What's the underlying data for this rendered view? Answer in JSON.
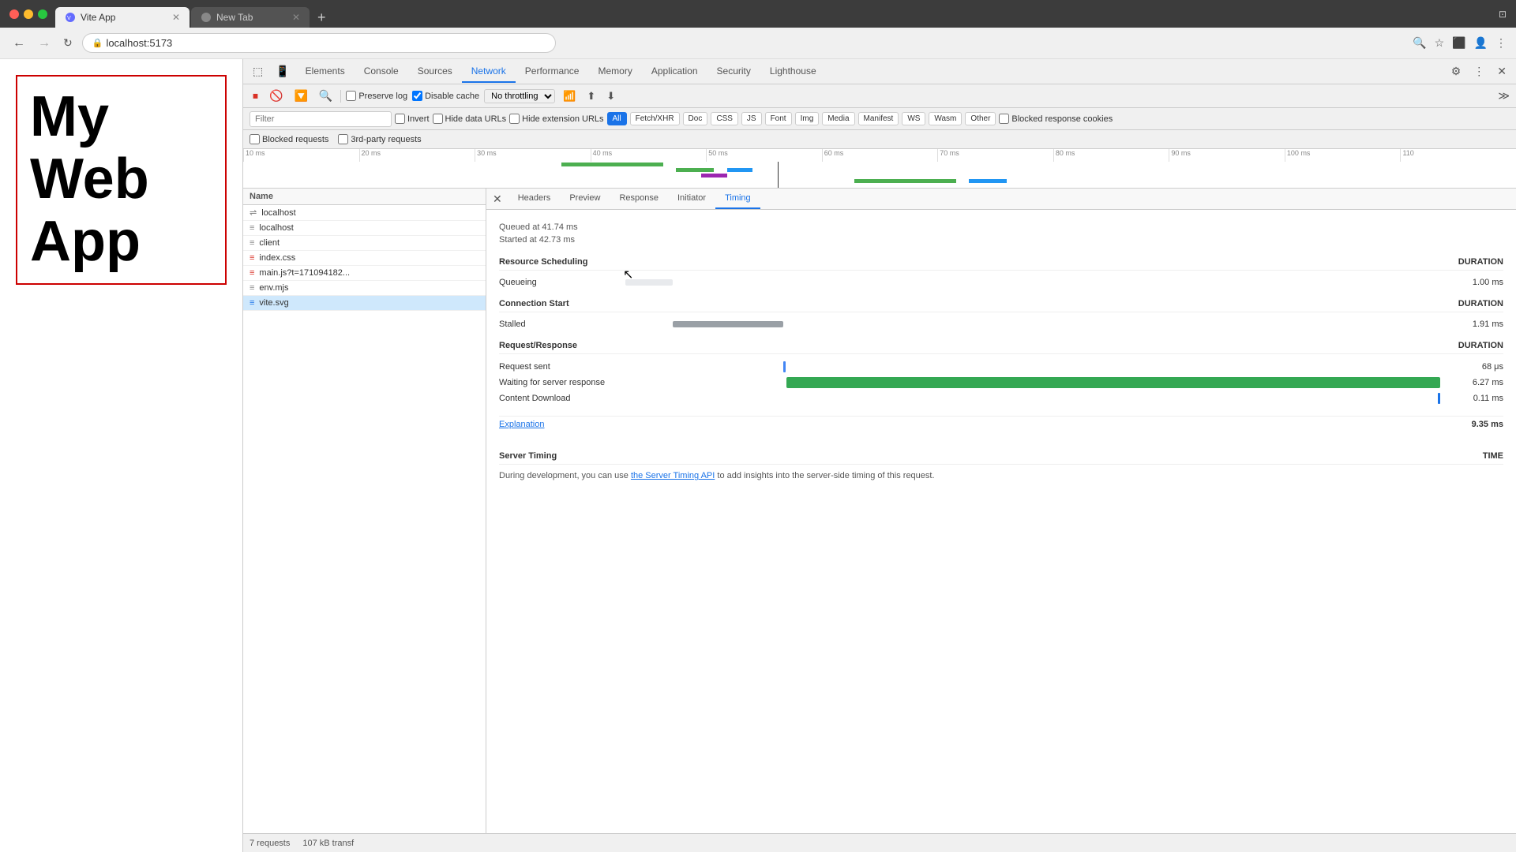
{
  "browser": {
    "tab1_title": "Vite App",
    "tab2_title": "New Tab",
    "url": "localhost:5173"
  },
  "webpage": {
    "title": "My Web App"
  },
  "devtools": {
    "tabs": [
      "Elements",
      "Console",
      "Sources",
      "Network",
      "Performance",
      "Memory",
      "Application",
      "Security",
      "Lighthouse"
    ],
    "active_tab": "Network"
  },
  "network_toolbar": {
    "preserve_log": "Preserve log",
    "disable_cache": "Disable cache",
    "throttle": "No throttling"
  },
  "filter_bar": {
    "placeholder": "Filter",
    "invert_label": "Invert",
    "hide_data_urls": "Hide data URLs",
    "hide_ext_urls": "Hide extension URLs",
    "all_btn": "All",
    "fetch_xhr": "Fetch/XHR",
    "doc": "Doc",
    "css": "CSS",
    "js": "JS",
    "font": "Font",
    "img": "Img",
    "media": "Media",
    "manifest": "Manifest",
    "ws": "WS",
    "wasm": "Wasm",
    "other": "Other",
    "blocked_response": "Blocked response cookies"
  },
  "filter_extra": {
    "blocked_requests": "Blocked requests",
    "third_party": "3rd-party requests"
  },
  "timeline": {
    "marks": [
      "10 ms",
      "20 ms",
      "30 ms",
      "40 ms",
      "50 ms",
      "60 ms",
      "70 ms",
      "80 ms",
      "90 ms",
      "100 ms",
      "110"
    ]
  },
  "file_list": {
    "header": "Name",
    "items": [
      {
        "name": "localhost",
        "icon": "link",
        "type": "link"
      },
      {
        "name": "localhost",
        "icon": "link",
        "type": "link"
      },
      {
        "name": "client",
        "icon": "js",
        "type": "js"
      },
      {
        "name": "index.css",
        "icon": "css",
        "type": "css"
      },
      {
        "name": "main.js?t=171094182...",
        "icon": "js",
        "type": "js"
      },
      {
        "name": "env.mjs",
        "icon": "js",
        "type": "js"
      },
      {
        "name": "vite.svg",
        "icon": "img",
        "type": "img",
        "selected": true
      }
    ]
  },
  "detail_tabs": [
    "Headers",
    "Preview",
    "Response",
    "Initiator",
    "Timing"
  ],
  "active_detail_tab": "Timing",
  "timing": {
    "queued_at": "Queued at 41.74 ms",
    "started_at": "Started at 42.73 ms",
    "resource_scheduling": "Resource Scheduling",
    "duration_label": "DURATION",
    "queueing_label": "Queueing",
    "queueing_duration": "1.00 ms",
    "connection_start": "Connection Start",
    "stalled_label": "Stalled",
    "stalled_duration": "1.91 ms",
    "request_response": "Request/Response",
    "request_sent_label": "Request sent",
    "request_sent_duration": "68 μs",
    "waiting_label": "Waiting for server response",
    "waiting_duration": "6.27 ms",
    "download_label": "Content Download",
    "download_duration": "0.11 ms",
    "explanation_link": "Explanation",
    "total_duration": "9.35 ms",
    "server_timing_header": "Server Timing",
    "time_label": "TIME",
    "server_timing_desc": "During development, you can use ",
    "server_timing_link": "the Server Timing API",
    "server_timing_rest": " to add insights into the server-side timing of this request."
  },
  "status_bar": {
    "requests": "7 requests",
    "transfer": "107 kB transf"
  }
}
